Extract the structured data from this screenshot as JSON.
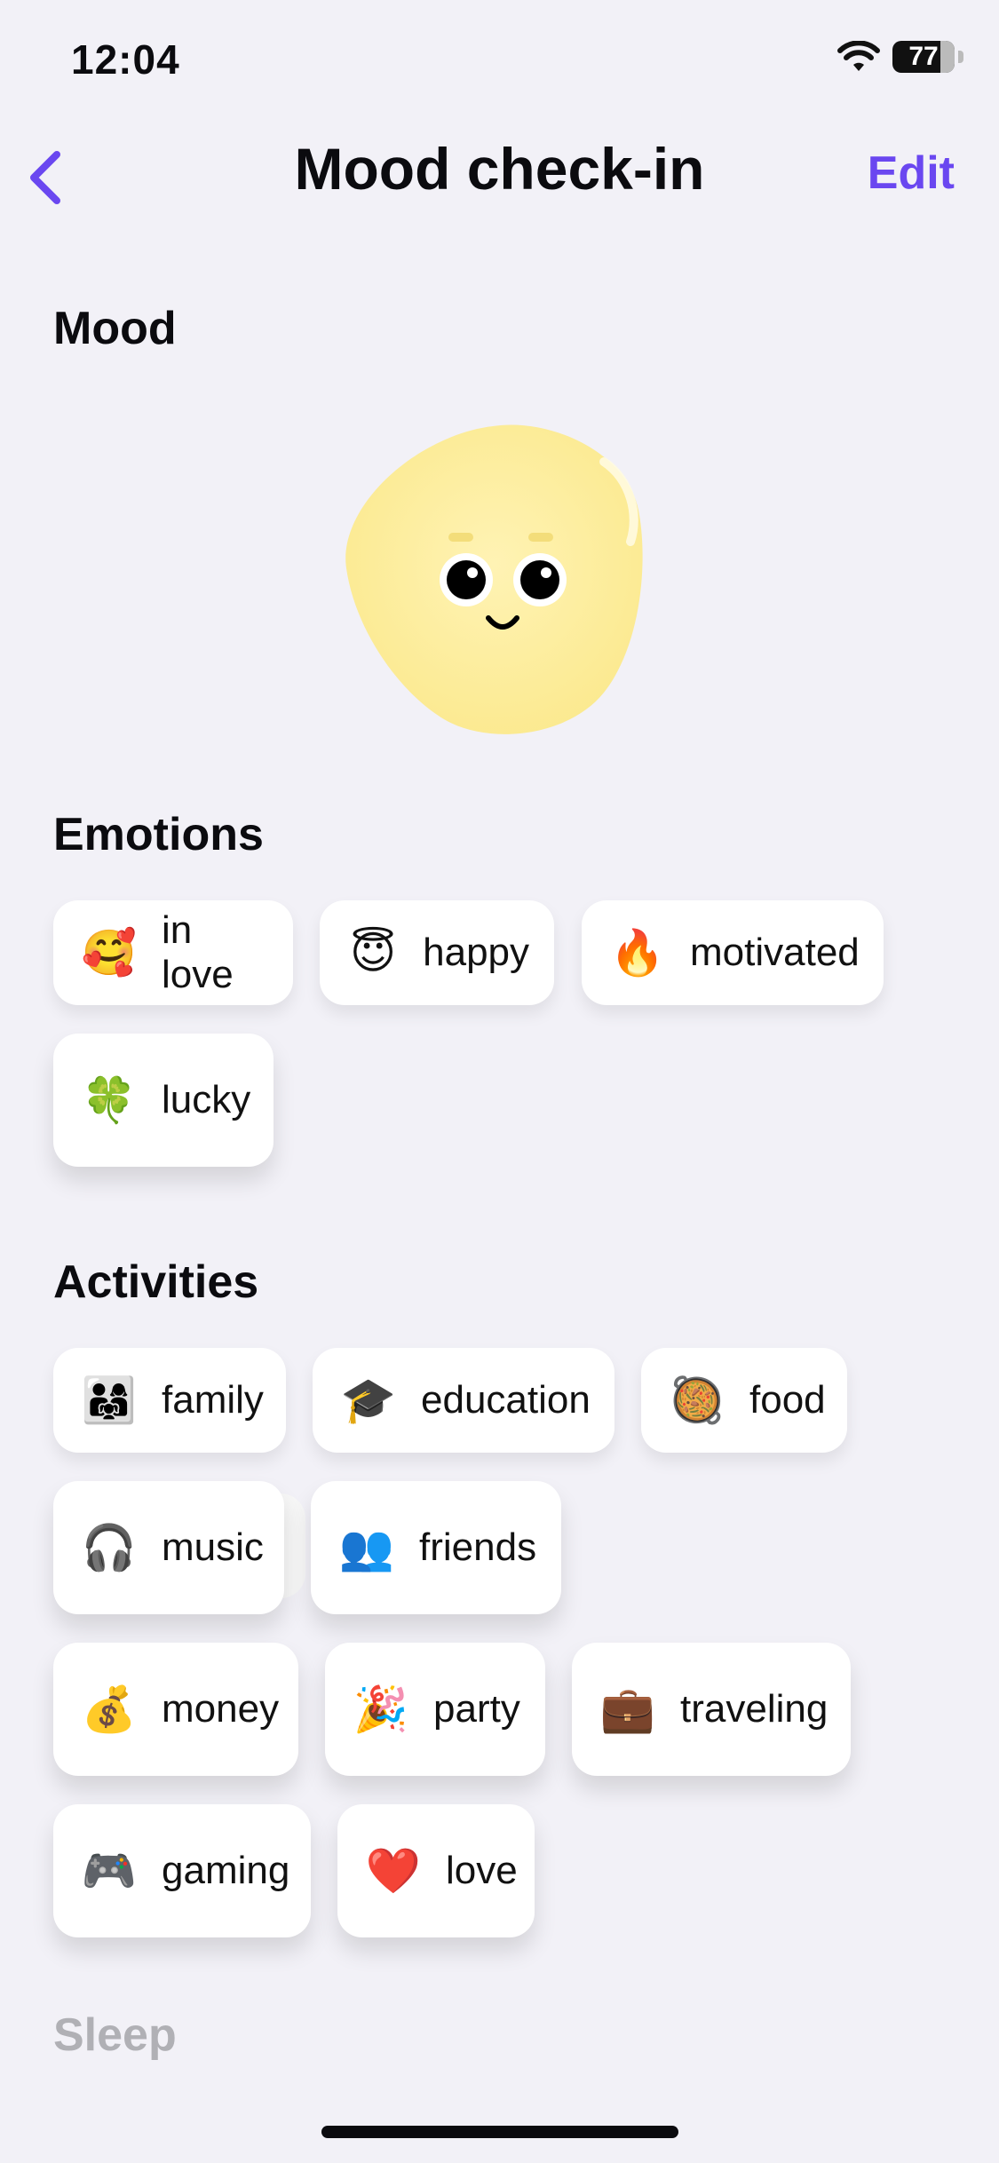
{
  "status_bar": {
    "time": "12:04",
    "battery_percent_label": "77",
    "battery_level": 0.77
  },
  "nav": {
    "title": "Mood check-in",
    "edit_label": "Edit",
    "back_icon": "chevron-left-icon"
  },
  "sections": {
    "mood": "Mood",
    "emotions": "Emotions",
    "activities": "Activities",
    "sleep": "Sleep"
  },
  "emotions": [
    {
      "emoji": "🥰",
      "label": "in love"
    },
    {
      "emoji": "😇",
      "label": "happy"
    },
    {
      "emoji": "🔥",
      "label": "motivated"
    },
    {
      "emoji": "🍀",
      "label": "lucky"
    }
  ],
  "activities": [
    {
      "emoji": "👨‍👩‍👧",
      "label": "family"
    },
    {
      "emoji": "🎓",
      "label": "education"
    },
    {
      "emoji": "🥘",
      "label": "food"
    },
    {
      "emoji": "🎧",
      "label": "music"
    },
    {
      "emoji": "👥",
      "label": "friends"
    },
    {
      "emoji": "💰",
      "label": "money"
    },
    {
      "emoji": "🎉",
      "label": "party"
    },
    {
      "emoji": "💼",
      "label": "traveling"
    },
    {
      "emoji": "🎮",
      "label": "gaming"
    },
    {
      "emoji": "❤️",
      "label": "love"
    }
  ],
  "colors": {
    "accent": "#6a47f0",
    "background": "#f2f1f7",
    "blob": "#fdf0a8"
  }
}
